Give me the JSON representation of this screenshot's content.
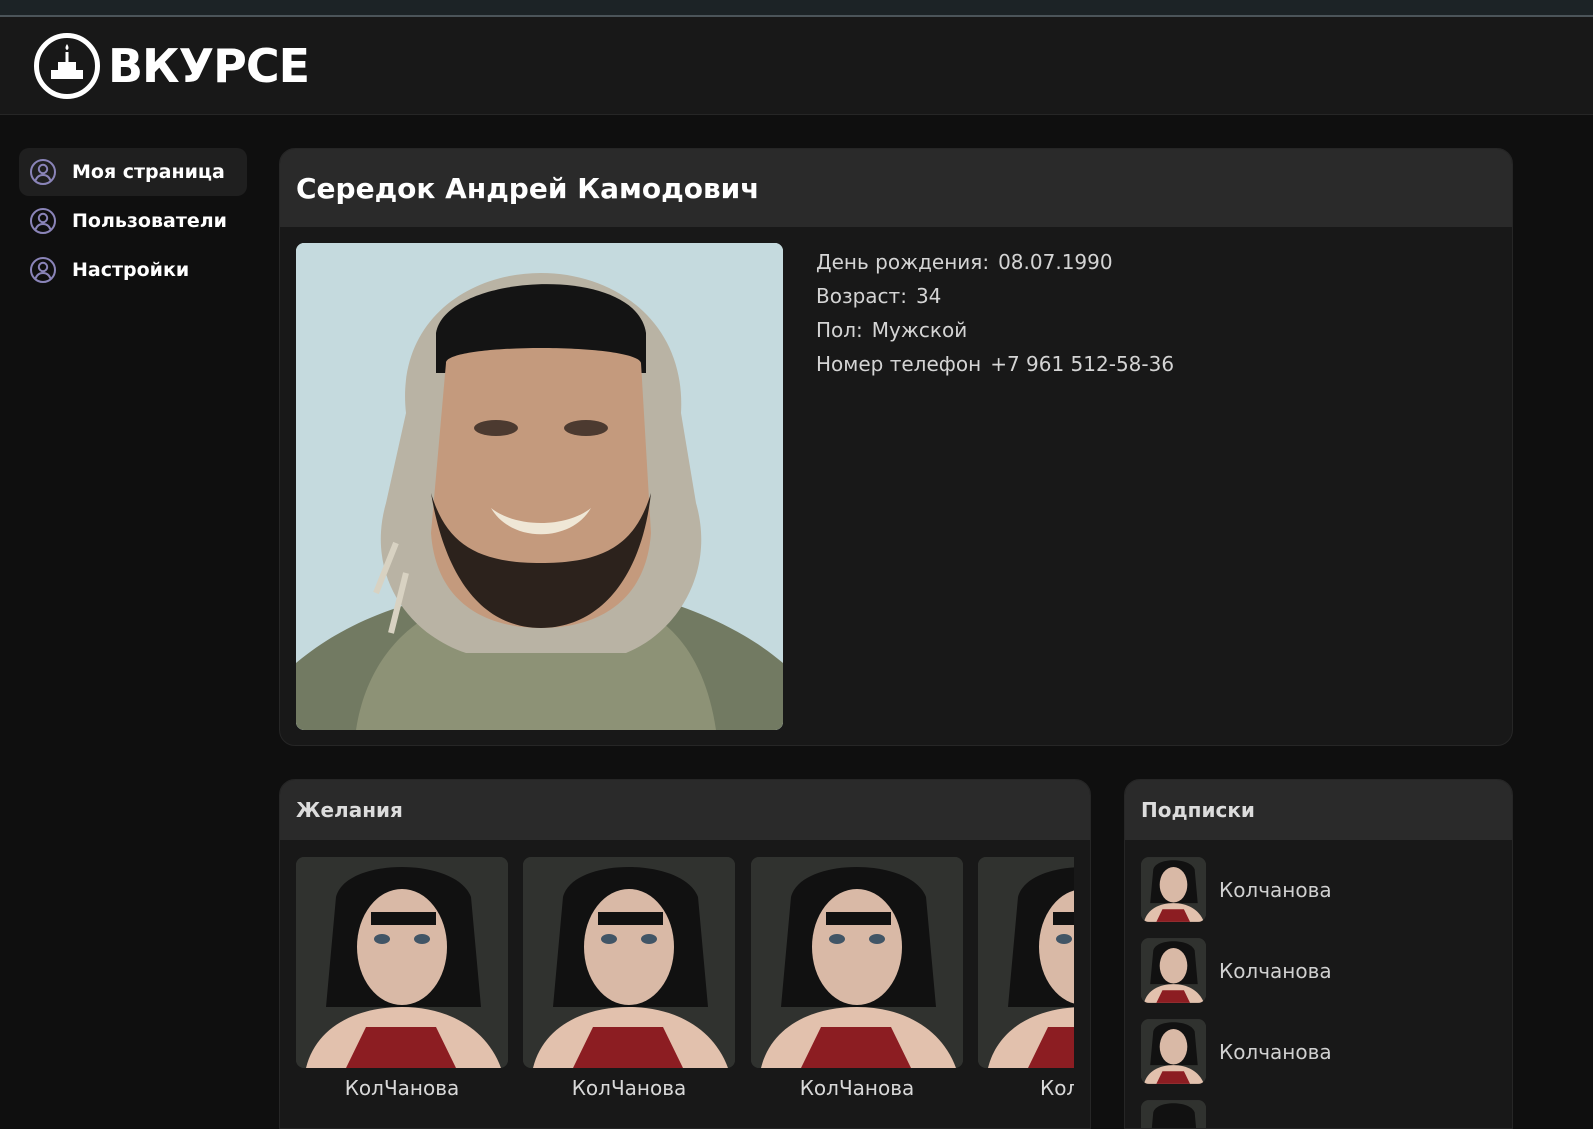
{
  "header": {
    "logo_text": "ВКУРСЕ",
    "logo_icon": "cake-icon"
  },
  "sidebar": {
    "items": [
      {
        "label": "Моя страница",
        "icon": "user-circle-icon",
        "active": true
      },
      {
        "label": "Пользователи",
        "icon": "user-circle-icon",
        "active": false
      },
      {
        "label": "Настройки",
        "icon": "user-circle-icon",
        "active": false
      }
    ]
  },
  "profile": {
    "name": "Середок Андрей Камодович",
    "fields": [
      {
        "label": "День рождения:",
        "value": "08.07.1990"
      },
      {
        "label": "Возраст:",
        "value": "34"
      },
      {
        "label": "Пол:",
        "value": "Мужской"
      },
      {
        "label": "Номер телефон",
        "value": "+7 961 512-58-36"
      }
    ]
  },
  "wishes": {
    "title": "Желания",
    "items": [
      {
        "name": "КолЧанова"
      },
      {
        "name": "КолЧанова"
      },
      {
        "name": "КолЧанова"
      },
      {
        "name": "Кол"
      }
    ]
  },
  "subscriptions": {
    "title": "Подписки",
    "items": [
      {
        "name": "Колчанова"
      },
      {
        "name": "Колчанова"
      },
      {
        "name": "Колчанова"
      }
    ]
  },
  "colors": {
    "background": "#0f0f0f",
    "card": "#181818",
    "card_header": "#2a2a2a",
    "icon_accent": "#8a84b8"
  }
}
